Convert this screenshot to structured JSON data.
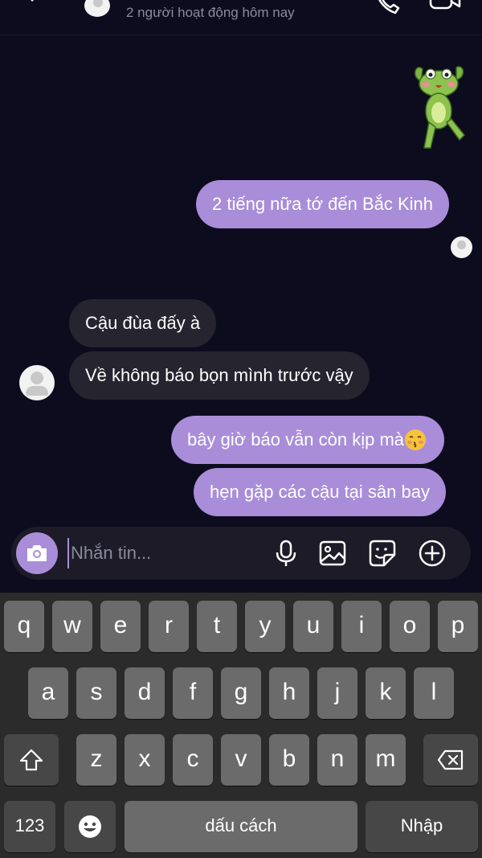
{
  "header": {
    "subtitle": "2 người hoạt động hôm nay"
  },
  "messages": [
    {
      "direction": "out",
      "text": "2 tiếng nữa tớ đến Bắc Kinh"
    },
    {
      "direction": "in",
      "text": "Cậu đùa đấy à"
    },
    {
      "direction": "in",
      "text": "Về không báo bọn mình trước vậy"
    },
    {
      "direction": "out",
      "text": "bây giờ báo vẫn còn kịp mà"
    },
    {
      "direction": "out",
      "text": "hẹn gặp các cậu tại sân bay"
    }
  ],
  "composer": {
    "placeholder": "Nhắn tin..."
  },
  "keyboard": {
    "row1": [
      "q",
      "w",
      "e",
      "r",
      "t",
      "y",
      "u",
      "i",
      "o",
      "p"
    ],
    "row2": [
      "a",
      "s",
      "d",
      "f",
      "g",
      "h",
      "j",
      "k",
      "l"
    ],
    "row3": [
      "z",
      "x",
      "c",
      "v",
      "b",
      "n",
      "m"
    ],
    "numbers_label": "123",
    "space_label": "dấu cách",
    "return_label": "Nhập"
  },
  "colors": {
    "background": "#0d0c1e",
    "outgoing_bubble": "#a98dd9",
    "incoming_bubble": "#26242f",
    "keyboard_bg": "#2b2b2b"
  },
  "icons": [
    "back-icon",
    "call-icon",
    "video-icon",
    "camera-icon",
    "mic-icon",
    "image-icon",
    "sticker-icon",
    "plus-icon",
    "shift-icon",
    "backspace-icon",
    "emoji-icon"
  ]
}
